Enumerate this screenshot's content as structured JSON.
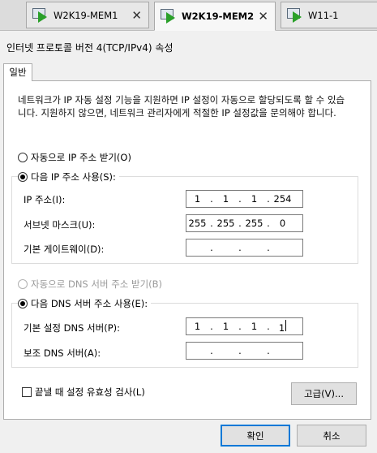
{
  "vm_tabs": [
    {
      "label": "W2K19-MEM1",
      "close": "✕"
    },
    {
      "label": "W2K19-MEM2",
      "close": "✕"
    },
    {
      "label": "W11-1",
      "close": ""
    }
  ],
  "dialog": {
    "title": "인터넷 프로토콜 버전 4(TCP/IPv4) 속성",
    "tab_general": "일반",
    "description": "네트워크가 IP 자동 설정 기능을 지원하면 IP 설정이 자동으로 할당되도록 할 수 있습니다. 지원하지 않으면, 네트워크 관리자에게 적절한 IP 설정값을 문의해야 합니다.",
    "auto_ip_label": "자동으로 IP 주소 받기(O)",
    "manual_ip_label": "다음 IP 주소 사용(S):",
    "ip_label": "IP 주소(I):",
    "ip": [
      "1",
      "1",
      "1",
      "254"
    ],
    "mask_label": "서브넷 마스크(U):",
    "mask": [
      "255",
      "255",
      "255",
      "0"
    ],
    "gateway_label": "기본 게이트웨이(D):",
    "gateway": [
      "",
      "",
      "",
      ""
    ],
    "auto_dns_label": "자동으로 DNS 서버 주소 받기(B)",
    "manual_dns_label": "다음 DNS 서버 주소 사용(E):",
    "dns1_label": "기본 설정 DNS 서버(P):",
    "dns1": [
      "1",
      "1",
      "1",
      "1"
    ],
    "dns2_label": "보조 DNS 서버(A):",
    "dns2": [
      "",
      "",
      "",
      ""
    ],
    "validate_label": "끝낼 때 설정 유효성 검사(L)",
    "advanced_button": "고급(V)...",
    "ok_button": "확인",
    "cancel_button": "취소"
  },
  "state": {
    "ip_mode": "manual",
    "dns_mode": "manual",
    "validate_checked": false
  },
  "colors": {
    "accent": "#0078d7",
    "vm_play": "#2aa02a"
  }
}
